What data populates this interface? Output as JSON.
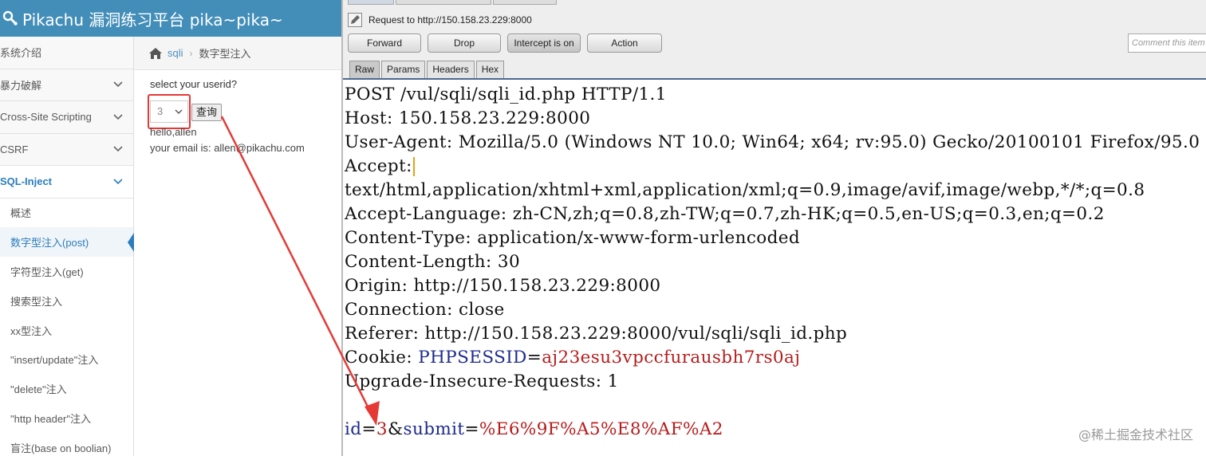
{
  "app": {
    "title": "Pikachu 漏洞练习平台 pika~pika~"
  },
  "sidebar": {
    "items": [
      {
        "label": "系统介绍"
      },
      {
        "label": "暴力破解"
      },
      {
        "label": "Cross-Site Scripting"
      },
      {
        "label": "CSRF"
      },
      {
        "label": "SQL-Inject"
      }
    ],
    "sub_items": [
      {
        "label": "概述"
      },
      {
        "label": "数字型注入(post)"
      },
      {
        "label": "字符型注入(get)"
      },
      {
        "label": "搜索型注入"
      },
      {
        "label": "xx型注入"
      },
      {
        "label": "\"insert/update\"注入"
      },
      {
        "label": "\"delete\"注入"
      },
      {
        "label": "\"http header\"注入"
      },
      {
        "label": "盲注(base on boolian)"
      }
    ]
  },
  "breadcrumb": {
    "link": "sqli",
    "current": "数字型注入"
  },
  "form": {
    "prompt": "select your userid?",
    "selected": "3",
    "button": "查询",
    "result_line1": "hello,allen",
    "result_line2": "your email is: allen@pikachu.com"
  },
  "burp": {
    "request_to": "Request to http://150.158.23.229:8000",
    "buttons": {
      "forward": "Forward",
      "drop": "Drop",
      "intercept": "Intercept is on",
      "action": "Action"
    },
    "comment_placeholder": "Comment this item",
    "view_tabs": [
      "Raw",
      "Params",
      "Headers",
      "Hex"
    ],
    "lines": {
      "l1": "POST /vul/sqli/sqli_id.php HTTP/1.1",
      "l2": "Host: 150.158.23.229:8000",
      "l3": "User-Agent: Mozilla/5.0 (Windows NT 10.0; Win64; x64; rv:95.0) Gecko/20100101 Firefox/95.0",
      "l4": "Accept:",
      "l5": "text/html,application/xhtml+xml,application/xml;q=0.9,image/avif,image/webp,*/*;q=0.8",
      "l6": "Accept-Language: zh-CN,zh;q=0.8,zh-TW;q=0.7,zh-HK;q=0.5,en-US;q=0.3,en;q=0.2",
      "l7": "Content-Type: application/x-www-form-urlencoded",
      "l8": "Content-Length: 30",
      "l9": "Origin: http://150.158.23.229:8000",
      "l10": "Connection: close",
      "l11": "Referer: http://150.158.23.229:8000/vul/sqli/sqli_id.php",
      "cookie_key": "Cookie: ",
      "cookie_name": "PHPSESSID",
      "cookie_eq": "=",
      "cookie_value": "aj23esu3vpccfurausbh7rs0aj",
      "l13": "Upgrade-Insecure-Requests: 1",
      "body_id_name": "id",
      "body_eq1": "=",
      "body_id_value": "3",
      "body_amp": "&",
      "body_submit_name": "submit",
      "body_eq2": "=",
      "body_submit_value": "%E6%9F%A5%E8%AF%A2"
    }
  },
  "watermark": "@稀土掘金技术社区",
  "colors": {
    "topbar": "#438eb9",
    "active_text": "#2b7dbc",
    "annotation_red": "#e53935",
    "param_name": "#1e2b8f",
    "param_value": "#b71c1c"
  }
}
